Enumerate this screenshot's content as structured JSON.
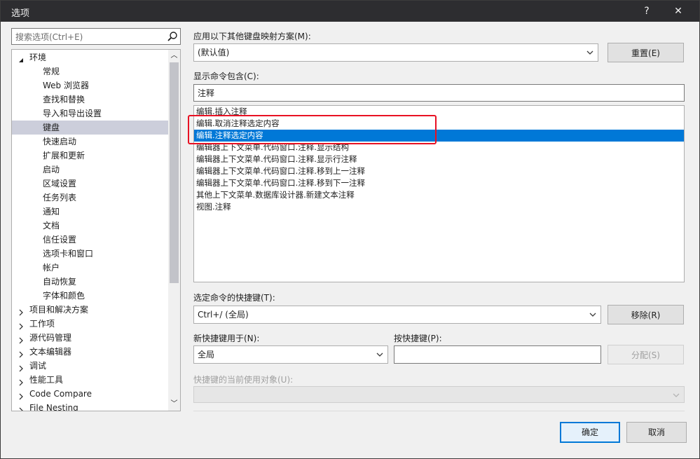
{
  "window": {
    "title": "选项",
    "help_label": "?",
    "close_label": "✕"
  },
  "search": {
    "placeholder": "搜索选项(Ctrl+E)"
  },
  "tree": {
    "items": [
      {
        "label": "环境",
        "expanded": true
      },
      {
        "label": "常规"
      },
      {
        "label": "Web 浏览器"
      },
      {
        "label": "查找和替换"
      },
      {
        "label": "导入和导出设置"
      },
      {
        "label": "键盘",
        "selected": true
      },
      {
        "label": "快速启动"
      },
      {
        "label": "扩展和更新"
      },
      {
        "label": "启动"
      },
      {
        "label": "区域设置"
      },
      {
        "label": "任务列表"
      },
      {
        "label": "通知"
      },
      {
        "label": "文档"
      },
      {
        "label": "信任设置"
      },
      {
        "label": "选项卡和窗口"
      },
      {
        "label": "帐户"
      },
      {
        "label": "自动恢复"
      },
      {
        "label": "字体和颜色"
      },
      {
        "label": "项目和解决方案",
        "expanded": false
      },
      {
        "label": "工作项",
        "expanded": false
      },
      {
        "label": "源代码管理",
        "expanded": false
      },
      {
        "label": "文本编辑器",
        "expanded": false
      },
      {
        "label": "调试",
        "expanded": false
      },
      {
        "label": "性能工具",
        "expanded": false
      },
      {
        "label": "Code Compare",
        "expanded": false
      },
      {
        "label": "File Nesting",
        "expanded": false
      }
    ]
  },
  "mapping": {
    "label": "应用以下其他键盘映射方案(M):",
    "value": "(默认值)",
    "reset_label": "重置(E)"
  },
  "filter": {
    "label": "显示命令包含(C):",
    "value": "注释"
  },
  "commands": {
    "items": [
      {
        "label": "编辑.插入注释"
      },
      {
        "label": "编辑.取消注释选定内容"
      },
      {
        "label": "编辑.注释选定内容",
        "selected": true
      },
      {
        "label": "编辑器上下文菜单.代码窗口.注释.显示结构"
      },
      {
        "label": "编辑器上下文菜单.代码窗口.注释.显示行注释"
      },
      {
        "label": "编辑器上下文菜单.代码窗口.注释.移到上一注释"
      },
      {
        "label": "编辑器上下文菜单.代码窗口.注释.移到下一注释"
      },
      {
        "label": "其他上下文菜单.数据库设计器.新建文本注释"
      },
      {
        "label": "视图.注释"
      }
    ]
  },
  "shortcut": {
    "label": "选定命令的快捷键(T):",
    "value": "Ctrl+/ (全局)",
    "remove_label": "移除(R)"
  },
  "new_shortcut": {
    "use_in_label": "新快捷键用于(N):",
    "use_in_value": "全局",
    "press_label": "按快捷键(P):",
    "press_value": "",
    "assign_label": "分配(S)"
  },
  "current_use": {
    "label": "快捷键的当前使用对象(U):",
    "value": ""
  },
  "footer": {
    "ok_label": "确定",
    "cancel_label": "取消"
  },
  "colors": {
    "accent": "#0078d7",
    "highlight_box": "#e81123",
    "tree_selection": "#cccedb"
  }
}
